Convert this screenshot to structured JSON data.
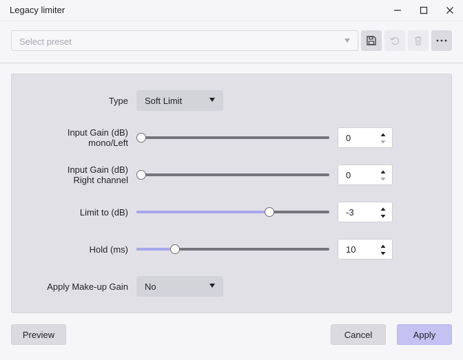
{
  "window": {
    "title": "Legacy limiter",
    "controls": [
      "minimize-icon",
      "maximize-icon",
      "close-icon"
    ]
  },
  "presets": {
    "placeholder": "Select preset",
    "buttons": [
      "save-icon",
      "undo-icon",
      "trash-icon",
      "more-icon"
    ]
  },
  "params": {
    "type": {
      "label": "Type",
      "value": "Soft Limit"
    },
    "input_gain_left": {
      "label_line1": "Input Gain (dB)",
      "label_line2": "mono/Left",
      "value": "0",
      "slider_fraction": 0.0
    },
    "input_gain_right": {
      "label_line1": "Input Gain (dB)",
      "label_line2": "Right channel",
      "value": "0",
      "slider_fraction": 0.0
    },
    "limit_to": {
      "label": "Limit to (dB)",
      "value": "-3",
      "slider_fraction": 0.69
    },
    "hold": {
      "label": "Hold (ms)",
      "value": "10",
      "slider_fraction": 0.2
    },
    "makeup_gain": {
      "label": "Apply Make-up Gain",
      "value": "No"
    }
  },
  "footer": {
    "preview": "Preview",
    "cancel": "Cancel",
    "apply": "Apply"
  },
  "colors": {
    "accent": "#a9a7ee",
    "primary_button": "#c4c2f2",
    "panel": "#e1e0e6"
  }
}
